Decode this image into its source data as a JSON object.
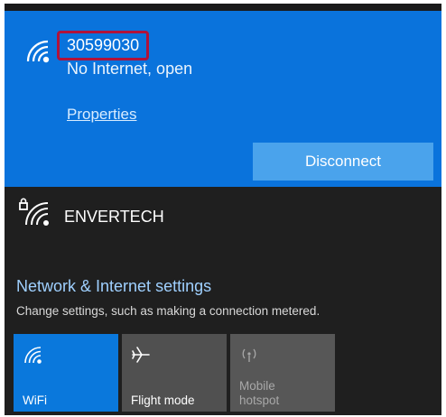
{
  "connected_network": {
    "ssid": "30599030",
    "status": "No Internet, open",
    "properties_label": "Properties",
    "disconnect_label": "Disconnect"
  },
  "other_network": {
    "name": "ENVERTECH"
  },
  "settings": {
    "title": "Network & Internet settings",
    "description": "Change settings, such as making a connection metered."
  },
  "tiles": [
    {
      "label": "WiFi",
      "icon": "wifi-icon",
      "state": "on"
    },
    {
      "label": "Flight mode",
      "icon": "airplane-icon",
      "state": "off"
    },
    {
      "label_line1": "Mobile",
      "label_line2": "hotspot",
      "icon": "hotspot-icon",
      "state": "disabled"
    }
  ],
  "colors": {
    "accent": "#0a73dc",
    "button": "#4aa3ec",
    "panel_bg": "#1f1f1f",
    "highlight_box": "#b0123a",
    "link": "#9fd0ff"
  }
}
